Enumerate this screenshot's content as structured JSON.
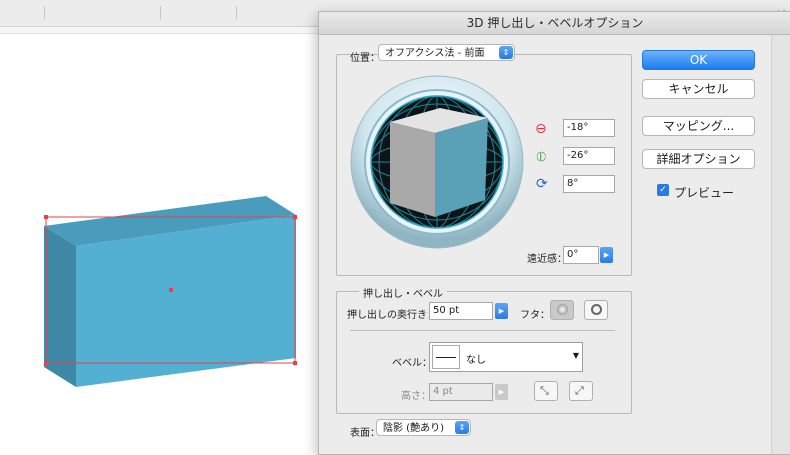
{
  "app": {
    "right_strip_text": "ビ"
  },
  "dialog": {
    "title": "3D 押し出し・ベベルオプション",
    "position": {
      "label": "位置：",
      "value": "オフアクシス法 - 前面"
    },
    "rotation": {
      "x_value": "-18°",
      "y_value": "-26°",
      "z_value": "8°"
    },
    "perspective": {
      "label": "遠近感：",
      "value": "0°"
    },
    "extrude_bevel": {
      "section_title": "押し出し・ベベル",
      "depth_label": "押し出しの奥行き：",
      "depth_value": "50 pt",
      "cap_label": "フタ：",
      "bevel_label": "ベベル：",
      "bevel_value": "なし",
      "height_label": "高さ：",
      "height_value": "4 pt"
    },
    "surface": {
      "label": "表面：",
      "value": "陰影 (艶あり)"
    },
    "buttons": {
      "ok": "OK",
      "cancel": "キャンセル",
      "mapping": "マッピング...",
      "more_options": "詳細オプション"
    },
    "preview": {
      "label": "プレビュー",
      "checked": true
    }
  },
  "colors": {
    "box_front": "#54b0d3",
    "box_side": "#3e88a6",
    "box_top": "#4a9cbd",
    "selection": "#e6424a",
    "accent": "#1b7cf2"
  }
}
